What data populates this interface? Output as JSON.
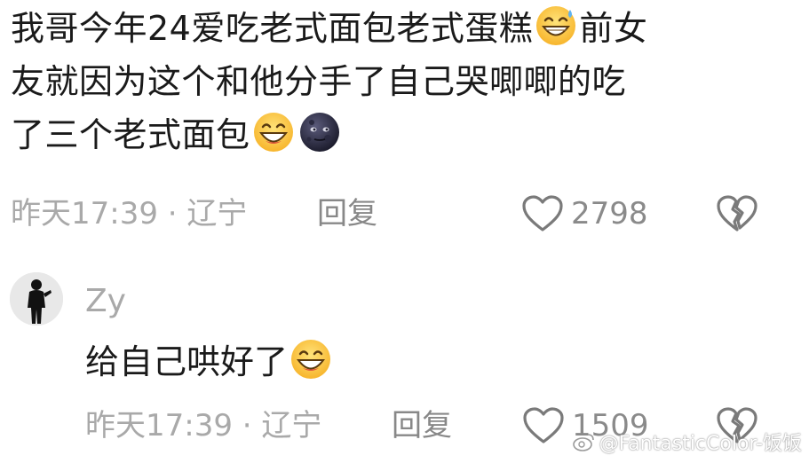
{
  "comment": {
    "line1_a": "我哥今年24爱吃老式面包老式蛋糕",
    "line1_b": "前女",
    "line2": "友就因为这个和他分手了自己哭唧唧的吃",
    "line3": "了三个老式面包",
    "emojis": [
      "grinning-sweat-icon",
      "grinning-icon",
      "new-moon-face-icon"
    ],
    "time_location": "昨天17:39 · 辽宁",
    "reply_label": "回复",
    "like_count": "2798"
  },
  "reply": {
    "author": "Zy",
    "text": "给自己哄好了",
    "emojis": [
      "grinning-icon"
    ],
    "time_location": "昨天17:39 · 辽宁",
    "reply_label": "回复",
    "like_count": "1509"
  },
  "watermark": "@FantasticColor-饭饭",
  "colors": {
    "text": "#1a1a1a",
    "meta": "#a9a9a9",
    "icon": "#8a8a8a",
    "background": "#ffffff"
  }
}
